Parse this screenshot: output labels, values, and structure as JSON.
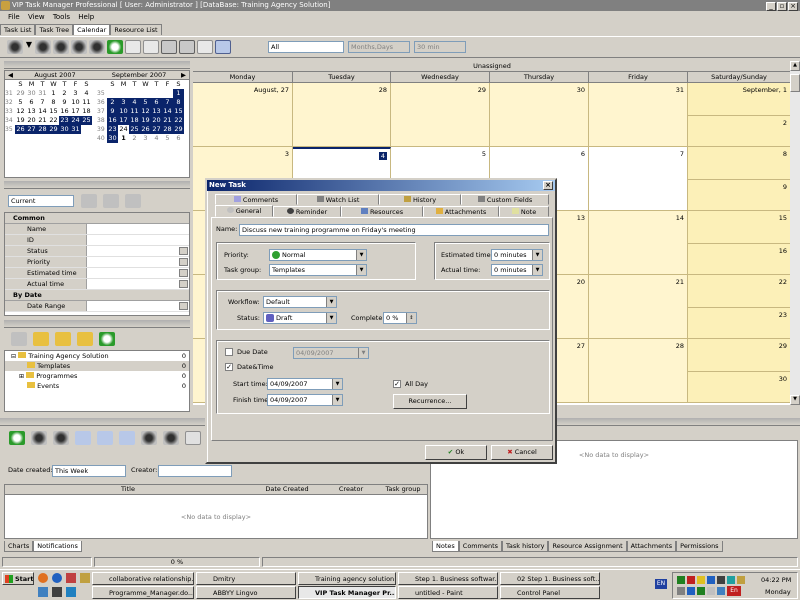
{
  "window": {
    "title": "VIP Task Manager Professional [ User: Administrator ] [DataBase: Training Agency Solution]"
  },
  "menu": [
    "File",
    "View",
    "Tools",
    "Help"
  ],
  "view_tabs": [
    "Task List",
    "Task Tree",
    "Calendar",
    "Resource List"
  ],
  "toolbar": {
    "filter_value": "All",
    "scale_value": "Months,Days",
    "interval_value": "30 min"
  },
  "mini_calendar": {
    "months": [
      {
        "title": "August 2007",
        "dow": [
          "S",
          "M",
          "T",
          "W",
          "T",
          "F",
          "S"
        ],
        "days": [
          "29",
          "30",
          "31",
          "1",
          "2",
          "3",
          "4",
          "5",
          "6",
          "7",
          "8",
          "9",
          "10",
          "11",
          "12",
          "13",
          "14",
          "15",
          "16",
          "17",
          "18",
          "19",
          "20",
          "21",
          "22",
          "23",
          "24",
          "25",
          "26",
          "27",
          "28",
          "29",
          "30",
          "31",
          ""
        ],
        "weeks": [
          "31",
          "32",
          "33",
          "34",
          "35"
        ]
      },
      {
        "title": "September 2007",
        "dow": [
          "S",
          "M",
          "T",
          "W",
          "T",
          "F",
          "S"
        ],
        "days": [
          "",
          "",
          "",
          "",
          "",
          "",
          "1",
          "2",
          "3",
          "4",
          "5",
          "6",
          "7",
          "8",
          "9",
          "10",
          "11",
          "12",
          "13",
          "14",
          "15",
          "16",
          "17",
          "18",
          "19",
          "20",
          "21",
          "22",
          "23",
          "24",
          "25",
          "26",
          "27",
          "28",
          "29",
          "30",
          "1",
          "2",
          "3",
          "4",
          "5",
          "6"
        ],
        "weeks": [
          "35",
          "36",
          "37",
          "38",
          "39",
          "40"
        ]
      }
    ]
  },
  "filter_panel": {
    "current": "Current",
    "sections": [
      {
        "title": "Common",
        "rows": [
          "Name",
          "ID",
          "Status",
          "Priority",
          "Estimated time",
          "Actual time"
        ]
      },
      {
        "title": "By Date",
        "rows": [
          "Date Range"
        ]
      }
    ]
  },
  "tree": {
    "items": [
      {
        "label": "Training Agency Solution",
        "count": "0"
      },
      {
        "label": "Templates",
        "count": "0"
      },
      {
        "label": "Programmes",
        "count": "0"
      },
      {
        "label": "Events",
        "count": "0"
      }
    ]
  },
  "calendar": {
    "header": "Unassigned",
    "days": [
      "Monday",
      "Tuesday",
      "Wednesday",
      "Thursday",
      "Friday",
      "Saturday/Sunday"
    ],
    "weeks": [
      {
        "cells": [
          "August, 27",
          "28",
          "29",
          "30",
          "31"
        ],
        "sat": "September, 1",
        "sun": "2"
      },
      {
        "cells": [
          "3",
          "4",
          "5",
          "6",
          "7"
        ],
        "sat": "8",
        "sun": "9"
      },
      {
        "cells": [
          "",
          "",
          "",
          "13",
          "14"
        ],
        "sat": "15",
        "sun": "16"
      },
      {
        "cells": [
          "",
          "",
          "",
          "20",
          "21"
        ],
        "sat": "22",
        "sun": "23"
      },
      {
        "cells": [
          "",
          "",
          "",
          "27",
          "28"
        ],
        "sat": "29",
        "sun": "30"
      }
    ]
  },
  "bottom": {
    "date_created_label": "Date created:",
    "date_created_value": "This Week",
    "creator_label": "Creator:",
    "columns": [
      "Title",
      "Date Created",
      "Creator",
      "Task group"
    ],
    "no_data": "<No data to display>",
    "left_tabs": [
      "Charts",
      "Notifications"
    ],
    "right_tabs": [
      "Notes",
      "Comments",
      "Task history",
      "Resource Assignment",
      "Attachments",
      "Permissions"
    ],
    "status_progress": "0 %"
  },
  "dialog": {
    "title": "New Task",
    "tabs_row1": [
      "Comments",
      "Watch List",
      "History",
      "Custom Fields"
    ],
    "tabs_row2": [
      "General",
      "Reminder",
      "Resources",
      "Attachments",
      "Note"
    ],
    "name_label": "Name:",
    "name_value": "Discuss new training programme on Friday's meeting",
    "priority_label": "Priority:",
    "priority_value": "Normal",
    "task_group_label": "Task group:",
    "task_group_value": "Templates",
    "est_label": "Estimated time:",
    "est_value": "0 minutes",
    "actual_label": "Actual time:",
    "actual_value": "0 minutes",
    "workflow_label": "Workflow:",
    "workflow_value": "Default",
    "status_label": "Status:",
    "status_value": "Draft",
    "complete_label": "Complete:",
    "complete_value": "0 %",
    "due_label": "Due Date",
    "due_value": "04/09/2007",
    "datetime_label": "Date&Time",
    "start_label": "Start time:",
    "start_value": "04/09/2007",
    "finish_label": "Finish time:",
    "finish_value": "04/09/2007",
    "allday_label": "All Day",
    "recurrence_label": "Recurrence...",
    "ok_label": "Ok",
    "cancel_label": "Cancel"
  },
  "taskbar": {
    "start": "Start",
    "row1": [
      "collaborative relationship...",
      "Dmitry",
      "Training agency solution",
      "Step 1. Business softwar...",
      "02 Step 1. Business soft..."
    ],
    "row2": [
      "Programme_Manager.do...",
      "ABBYY Lingvo",
      "VIP Task Manager Pr...",
      "untitled - Paint",
      "Control Panel"
    ],
    "lang": "EN",
    "lang2": "En",
    "time": "04:22 PM",
    "day": "Monday"
  },
  "colors": {
    "selection": "#0a246a",
    "calendar_cell": "#fff5cf",
    "dialog_title": "#0a246a"
  }
}
